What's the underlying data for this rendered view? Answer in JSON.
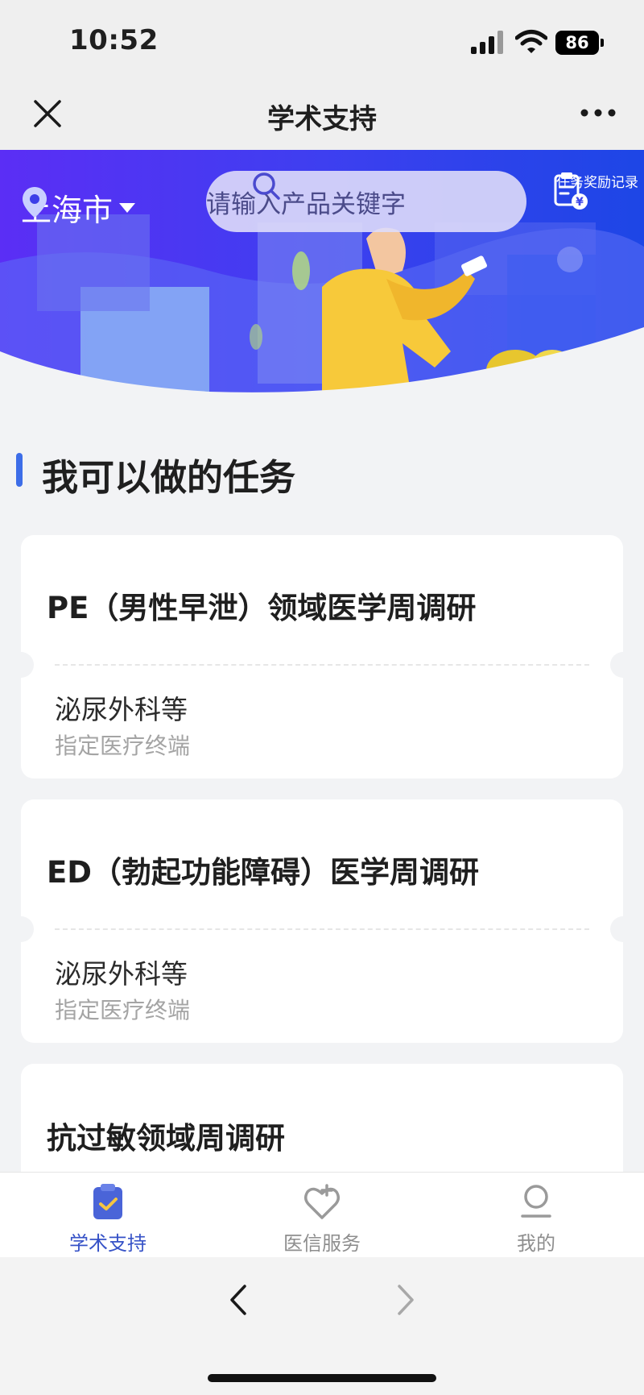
{
  "status": {
    "time": "10:52",
    "battery": "86"
  },
  "nav": {
    "title": "学术支持"
  },
  "banner": {
    "city": "上海市",
    "search_placeholder": "请输入产品关键字",
    "reward_label": "任务奖励记录"
  },
  "section": {
    "title": "我可以做的任务"
  },
  "tasks": [
    {
      "title": "PE（男性早泄）领域医学周调研",
      "dept": "泌尿外科等",
      "terminal": "指定医疗终端"
    },
    {
      "title": "ED（勃起功能障碍）医学周调研",
      "dept": "泌尿外科等",
      "terminal": "指定医疗终端"
    },
    {
      "title": "抗过敏领域周调研"
    }
  ],
  "tabs": [
    {
      "label": "学术支持",
      "icon": "clipboard-check-icon",
      "active": true
    },
    {
      "label": "医信服务",
      "icon": "heart-plus-icon",
      "active": false
    },
    {
      "label": "我的",
      "icon": "user-icon",
      "active": false
    }
  ],
  "colors": {
    "accent": "#3652c7",
    "banner_start": "#4a2cf0",
    "banner_end": "#1f47e6",
    "section_bar": "#3d6de8"
  }
}
